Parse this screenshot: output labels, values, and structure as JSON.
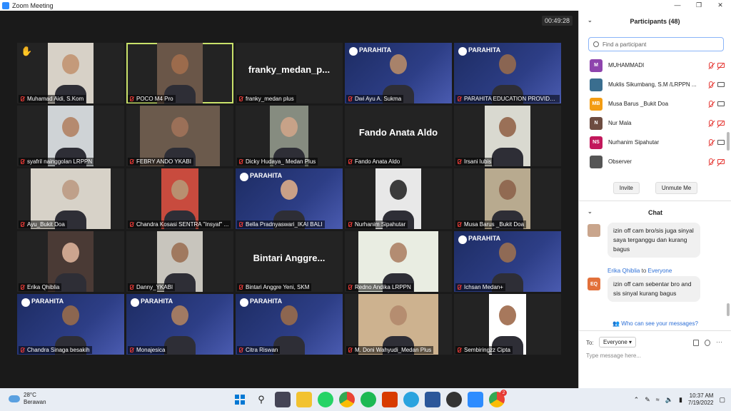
{
  "window": {
    "title": "Zoom Meeting",
    "min": "—",
    "max": "❐",
    "close": "✕"
  },
  "timer": "00:49:28",
  "tiles": [
    {
      "name": "Muhamad Aidi, S.Kom",
      "hand": true,
      "skin": "#c49a7a",
      "bg": "#d7d1c7",
      "w": 64
    },
    {
      "name": "POCO M4 Pro",
      "active": true,
      "skin": "#9c6b4c",
      "bg": "#6a5648",
      "w": 64,
      "pin": true
    },
    {
      "name": "franky_medan plus",
      "big": "franky_medan_p..."
    },
    {
      "name": "Dwi Ayu A. Sukma",
      "banner": "PARAHITA",
      "skin": "#a8826a",
      "w": 60
    },
    {
      "name": "PARAHITA EDUCATION PROVIDER",
      "banner": "PARAHITA",
      "skin": "#8a6552",
      "w": 60
    },
    {
      "name": "syafril nainggolan LRPPN",
      "skin": "#b58a6f",
      "bg": "#cfd3d6",
      "w": 64
    },
    {
      "name": "FEBRY ANDO YKABI",
      "skin": "#9b7058",
      "bg": "#6b5a4c",
      "w": 112
    },
    {
      "name": "Dicky Hudaya_ Medan Plus",
      "skin": "#c7a288",
      "bg": "#868c80",
      "w": 54
    },
    {
      "name": "Fando Anata Aldo",
      "big": "Fando Anata Aldo"
    },
    {
      "name": "Irsani lubis",
      "skin": "#9a7057",
      "bg": "#d9d9d0",
      "w": 64
    },
    {
      "name": "Ayu_Bukit Doa",
      "skin": "#bfa08a",
      "bg": "#d7d2c8",
      "w": 112
    },
    {
      "name": "Chandra Kosasi SENTRA \"Insyaf\" ...",
      "skin": "#b88f70",
      "bg": "#c84b3e",
      "w": 52
    },
    {
      "name": "Bella Pradnyaswari_IKAI BALI",
      "banner": "PARAHITA",
      "skin": "#c9a087",
      "w": 150
    },
    {
      "name": "Nurhanim Sipahutar",
      "skin": "#3b3b3b",
      "bg": "#e8e8e8",
      "w": 64
    },
    {
      "name": "Musa Barus _Bukit Doa",
      "skin": "#916a52",
      "bg": "#b8aa8f",
      "w": 64
    },
    {
      "name": "Erika Qhiblia",
      "skin": "#cca58f",
      "bg": "#4a3a35",
      "w": 64
    },
    {
      "name": "Danny_YKABI",
      "skin": "#a0795f",
      "bg": "#c8c5bd",
      "w": 64
    },
    {
      "name": "Bintari Anggre Yeni, SKM",
      "big": "Bintari  Anggre..."
    },
    {
      "name": "Redno Andika LRPPN",
      "skin": "#b38c72",
      "bg": "#e9ede2",
      "w": 112
    },
    {
      "name": "Ichsan Medan+",
      "banner": "PARAHITA",
      "skin": "#8f6a55",
      "w": 112
    },
    {
      "name": "Chandra Sinaga besakih",
      "banner": "PARAHITA",
      "skin": "#8c6650",
      "w": 64
    },
    {
      "name": "Monajesica",
      "banner": "PARAHITA",
      "skin": "#a17a63",
      "w": 48
    },
    {
      "name": "Citra Riswan",
      "banner": "PARAHITA",
      "skin": "#8d6650",
      "w": 150
    },
    {
      "name": "M. Doni Wahyudi_Medan Plus",
      "skin": "#b58d70",
      "bg": "#cdb28f",
      "w": 112
    },
    {
      "name": "Sembiringzz Cipta",
      "skin": "#a7785c",
      "bg": "#ffffff",
      "w": 52
    }
  ],
  "participants": {
    "header": "Participants (48)",
    "search_placeholder": "Find a participant",
    "list": [
      {
        "initials": "M",
        "color": "#8e44ad",
        "name": "MUHAMMADI",
        "cam": "off"
      },
      {
        "initials": "",
        "color": "#3a6e8f",
        "name": "Muklis Sikumbang, S.M /LRPPN ...",
        "cam": "on"
      },
      {
        "initials": "MB",
        "color": "#f39c12",
        "name": "Musa Barus _Bukit Doa",
        "cam": "on"
      },
      {
        "initials": "N",
        "color": "#6d4c41",
        "name": "Nur Mala",
        "cam": "off"
      },
      {
        "initials": "NS",
        "color": "#c2185b",
        "name": "Nurhanim Sipahutar",
        "cam": "on"
      },
      {
        "initials": "",
        "color": "#555555",
        "name": "Observer",
        "cam": "off"
      }
    ],
    "invite": "Invite",
    "unmute": "Unmute Me"
  },
  "chat": {
    "header": "Chat",
    "messages": [
      {
        "from": "",
        "to": "",
        "text": "izin off cam bro/sis juga sinyal saya terganggu dan kurang bagus"
      },
      {
        "from": "Erika Qhiblia",
        "to": "Everyone",
        "text": "izin off cam sebentar bro and sis sinyal kurang bagus",
        "initials": "EQ"
      }
    ],
    "to_word": "to",
    "who_sees": "Who can see your messages?",
    "to_label": "To:",
    "recipient": "Everyone",
    "placeholder": "Type message here..."
  },
  "taskbar": {
    "temp": "28°C",
    "weather": "Berawan",
    "time": "10:37 AM",
    "date": "7/19/2022",
    "badge": "2"
  }
}
